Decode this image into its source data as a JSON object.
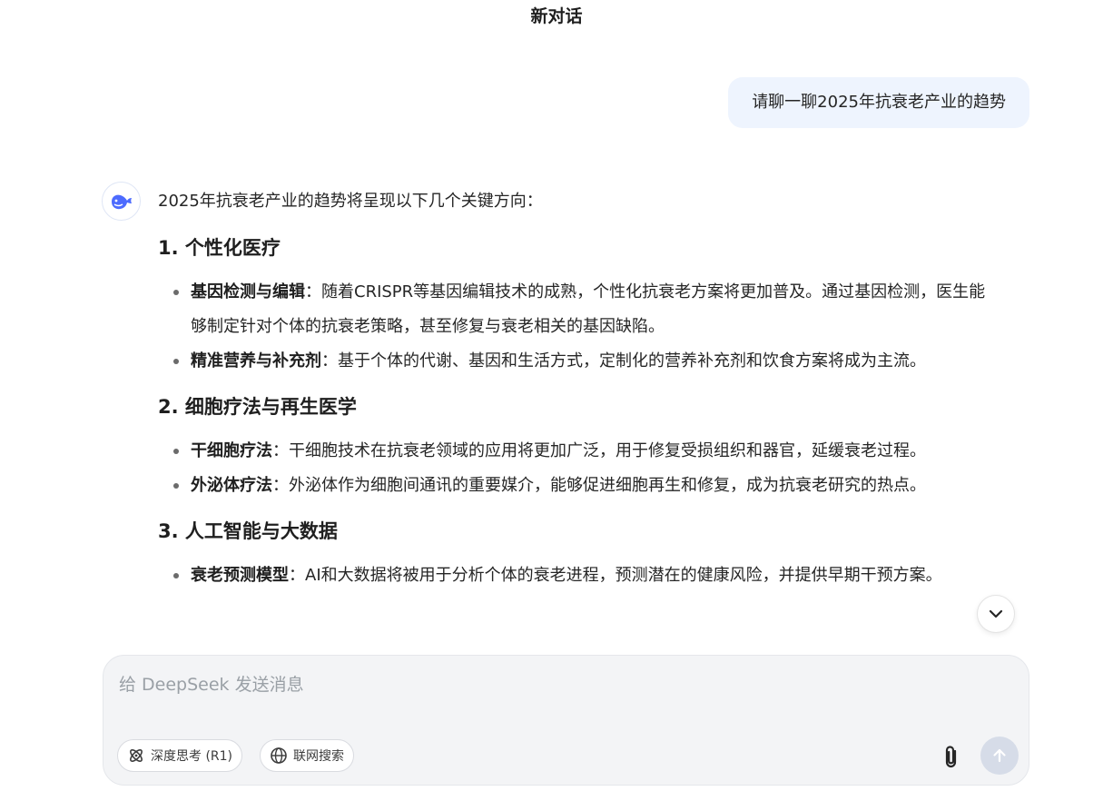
{
  "header": {
    "title": "新对话"
  },
  "user_message": "请聊一聊2025年抗衰老产业的趋势",
  "answer": {
    "intro": "2025年抗衰老产业的趋势将呈现以下几个关键方向：",
    "sections": [
      {
        "heading": "1. 个性化医疗",
        "items": [
          {
            "term": "基因检测与编辑",
            "text": "：随着CRISPR等基因编辑技术的成熟，个性化抗衰老方案将更加普及。通过基因检测，医生能够制定针对个体的抗衰老策略，甚至修复与衰老相关的基因缺陷。"
          },
          {
            "term": "精准营养与补充剂",
            "text": "：基于个体的代谢、基因和生活方式，定制化的营养补充剂和饮食方案将成为主流。"
          }
        ]
      },
      {
        "heading": "2. 细胞疗法与再生医学",
        "items": [
          {
            "term": "干细胞疗法",
            "text": "：干细胞技术在抗衰老领域的应用将更加广泛，用于修复受损组织和器官，延缓衰老过程。"
          },
          {
            "term": "外泌体疗法",
            "text": "：外泌体作为细胞间通讯的重要媒介，能够促进细胞再生和修复，成为抗衰老研究的热点。"
          }
        ]
      },
      {
        "heading": "3. 人工智能与大数据",
        "items": [
          {
            "term": "衰老预测模型",
            "text": "：AI和大数据将被用于分析个体的衰老进程，预测潜在的健康风险，并提供早期干预方案。"
          }
        ]
      }
    ]
  },
  "composer": {
    "placeholder": "给 DeepSeek 发送消息",
    "deep_think_label": "深度思考 (R1)",
    "web_search_label": "联网搜索"
  },
  "icons": {
    "avatar": "deepseek-whale-icon",
    "scroll": "chevron-down-icon",
    "attach": "paperclip-icon",
    "send": "arrow-up-icon",
    "deep_think": "atom-icon",
    "web_search": "globe-icon"
  },
  "colors": {
    "brand": "#4d6bfe",
    "user_bubble": "#eef4fe",
    "composer_bg": "#f3f4f6",
    "send_disabled": "#d6dce8"
  }
}
